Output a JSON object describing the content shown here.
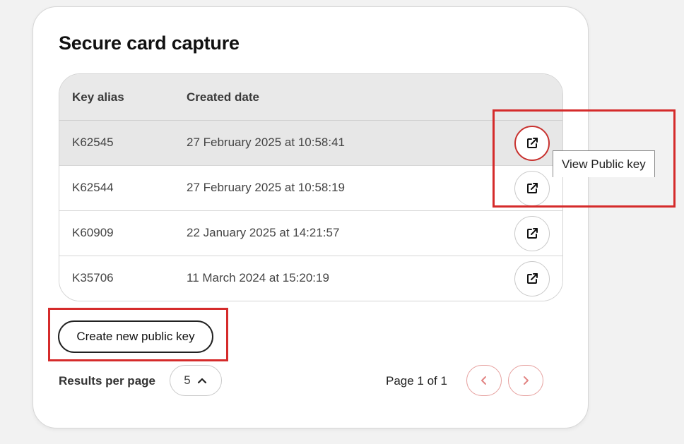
{
  "card": {
    "title": "Secure card capture"
  },
  "table": {
    "columns": [
      "Key alias",
      "Created date"
    ],
    "rows": [
      {
        "alias": "K62545",
        "created": "27 February 2025 at 10:58:41",
        "action_icon": "external-link-icon",
        "selected": true
      },
      {
        "alias": "K62544",
        "created": "27 February 2025 at 10:58:19",
        "action_icon": "external-link-icon",
        "selected": false
      },
      {
        "alias": "K60909",
        "created": "22 January 2025 at 14:21:57",
        "action_icon": "external-link-icon",
        "selected": false
      },
      {
        "alias": "K35706",
        "created": "11 March 2024 at 15:20:19",
        "action_icon": "external-link-icon",
        "selected": false
      }
    ]
  },
  "tooltip": {
    "text": "View Public key"
  },
  "actions": {
    "create_label": "Create new public key"
  },
  "pagination": {
    "results_per_page_label": "Results per page",
    "results_per_page_value": "5",
    "page_info": "Page 1 of 1",
    "prev_icon": "chevron-left-icon",
    "next_icon": "chevron-right-icon"
  },
  "colors": {
    "accent": "#c8322f",
    "annotation": "#d52b2b",
    "pager_border": "#e6a09e",
    "selected_row": "#e7e7e7"
  }
}
